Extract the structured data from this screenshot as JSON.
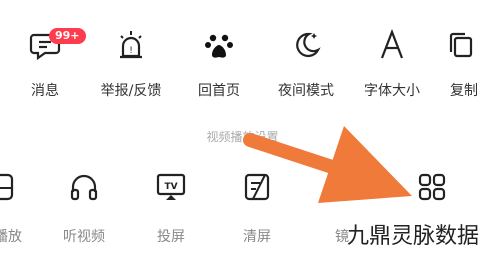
{
  "top_row": [
    {
      "label": "消息",
      "icon": "message-icon",
      "badge": "99+"
    },
    {
      "label": "举报/反馈",
      "icon": "report-alarm-icon"
    },
    {
      "label": "回首页",
      "icon": "home-paw-icon"
    },
    {
      "label": "夜间模式",
      "icon": "moon-icon"
    },
    {
      "label": "字体大小",
      "icon": "font-size-icon"
    },
    {
      "label": "复制",
      "icon": "copy-icon"
    }
  ],
  "section_title": "视频播放设置",
  "bottom_row": [
    {
      "label": "播放",
      "icon": "play-icon"
    },
    {
      "label": "听视频",
      "icon": "headphones-icon"
    },
    {
      "label": "投屏",
      "icon": "tv-cast-icon"
    },
    {
      "label": "清屏",
      "icon": "clear-screen-icon"
    },
    {
      "label": "镜",
      "icon": "mirror-icon"
    },
    {
      "label": "",
      "icon": "grid-icon"
    }
  ],
  "watermark": "九鼎灵脉数据",
  "colors": {
    "accent_arrow": "#f07a3a",
    "badge": "#ff3b4e"
  }
}
